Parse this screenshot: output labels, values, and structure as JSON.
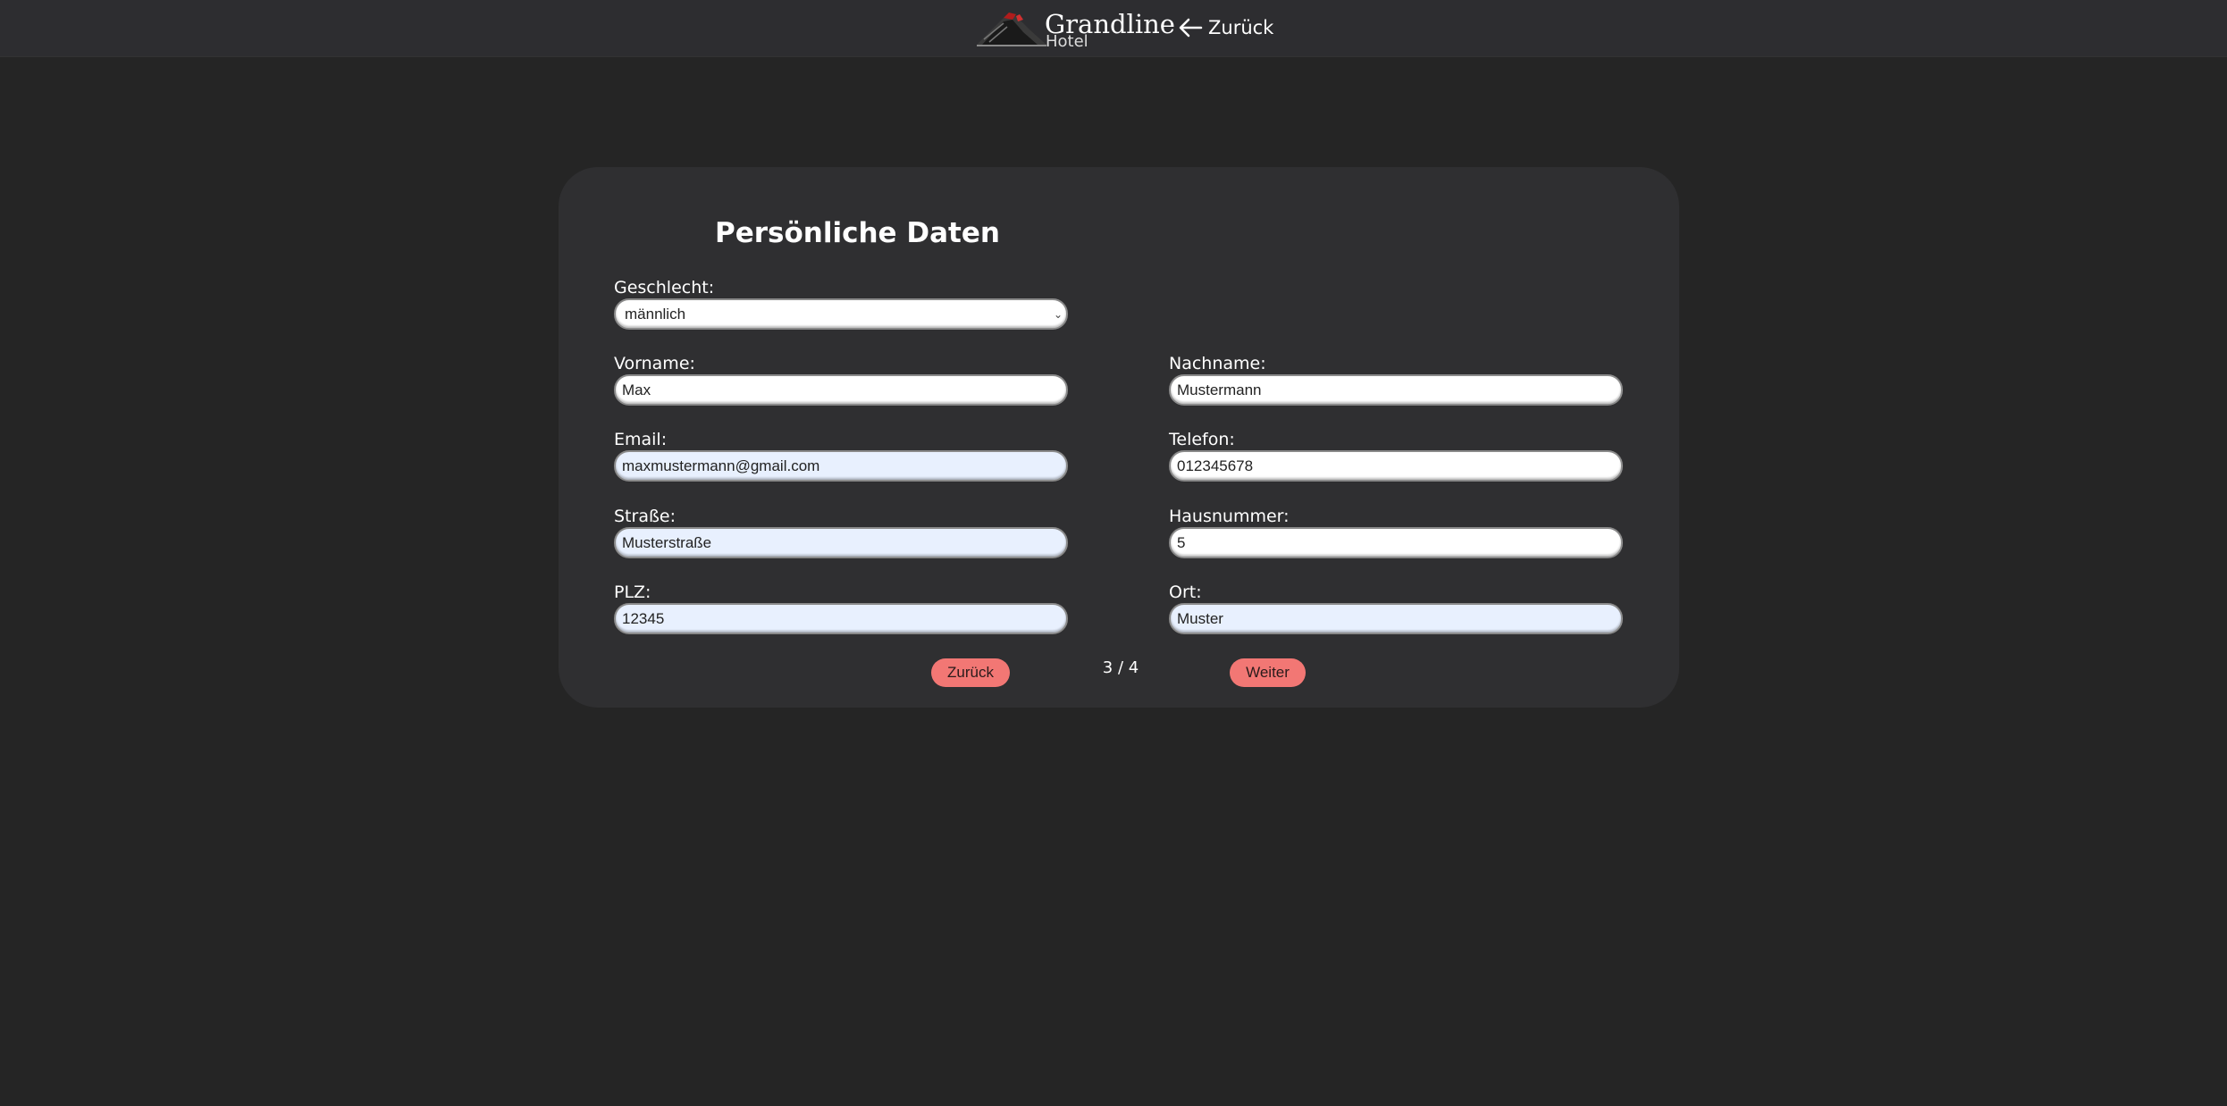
{
  "header": {
    "brand_name": "Grandline",
    "brand_sub": "Hotel",
    "back_label": "Zurück"
  },
  "form": {
    "title": "Persönliche Daten",
    "gender": {
      "label": "Geschlecht:",
      "value": "männlich"
    },
    "first_name": {
      "label": "Vorname:",
      "value": "Max"
    },
    "last_name": {
      "label": "Nachname:",
      "value": "Mustermann"
    },
    "email": {
      "label": "Email:",
      "value": "maxmustermann@gmail.com"
    },
    "phone": {
      "label": "Telefon:",
      "value": "012345678"
    },
    "street": {
      "label": "Straße:",
      "value": "Musterstraße"
    },
    "house_number": {
      "label": "Hausnummer:",
      "value": "5"
    },
    "zip": {
      "label": "PLZ:",
      "value": "12345"
    },
    "city": {
      "label": "Ort:",
      "value": "Muster"
    }
  },
  "nav": {
    "back_label": "Zurück",
    "step_current": "3",
    "step_total": "4",
    "step_text": "3 / 4",
    "next_label": "Weiter"
  },
  "colors": {
    "background": "#252525",
    "header": "#2d2d30",
    "card": "#2f2f31",
    "button": "#f27774",
    "autofill": "#e8f0fe"
  }
}
